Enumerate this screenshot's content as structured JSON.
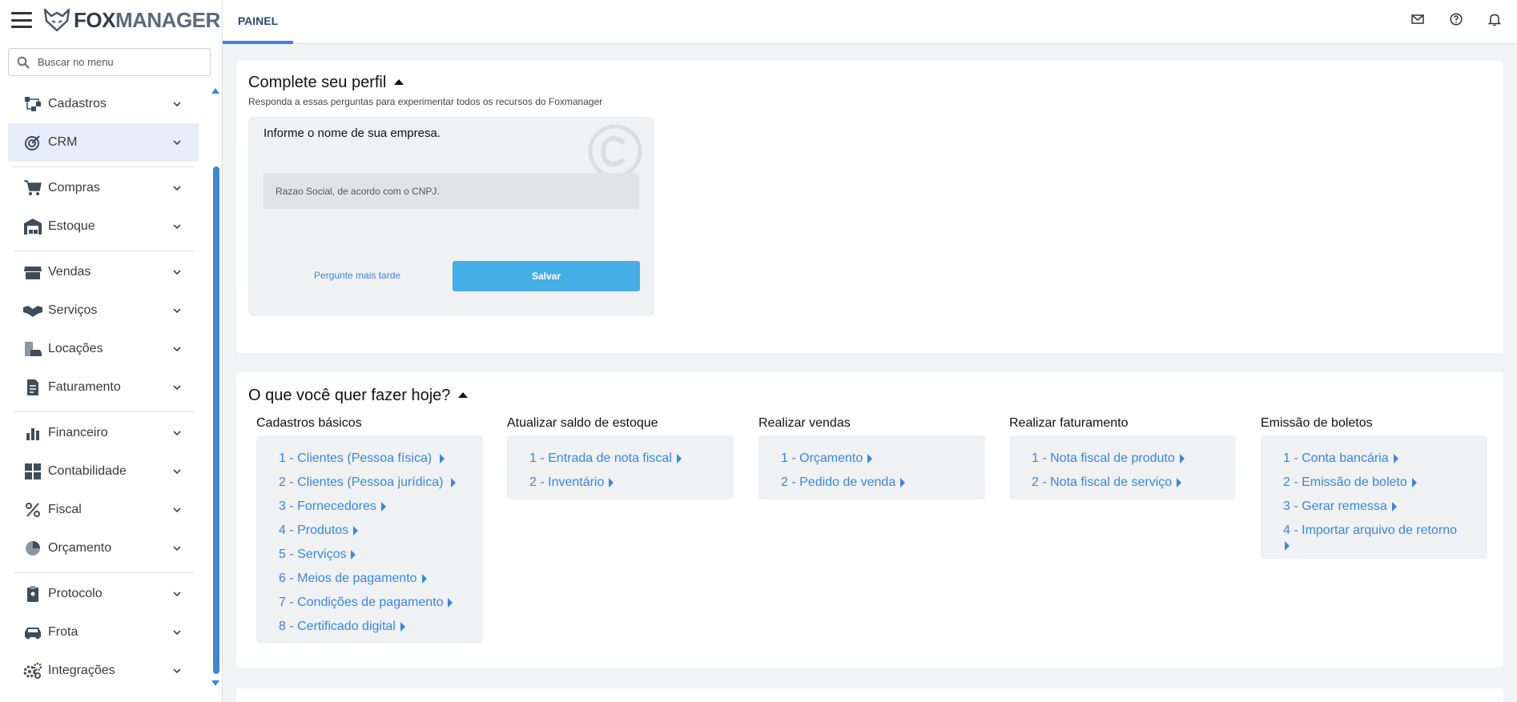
{
  "app": {
    "logo_text_part1": "FOX",
    "logo_text_part2": "MANAGER"
  },
  "search": {
    "placeholder": "Buscar no menu"
  },
  "sidebar": {
    "items": [
      {
        "label": "Cadastros",
        "icon": "hierarchy-icon"
      },
      {
        "label": "CRM",
        "icon": "target-icon"
      },
      {
        "label": "Compras",
        "icon": "cart-icon"
      },
      {
        "label": "Estoque",
        "icon": "warehouse-icon"
      },
      {
        "label": "Vendas",
        "icon": "store-icon"
      },
      {
        "label": "Serviços",
        "icon": "handshake-icon"
      },
      {
        "label": "Locações",
        "icon": "building-car-icon"
      },
      {
        "label": "Faturamento",
        "icon": "invoice-icon"
      },
      {
        "label": "Financeiro",
        "icon": "bar-chart-icon"
      },
      {
        "label": "Contabilidade",
        "icon": "calculator-icon"
      },
      {
        "label": "Fiscal",
        "icon": "percent-icon"
      },
      {
        "label": "Orçamento",
        "icon": "pie-chart-icon"
      },
      {
        "label": "Protocolo",
        "icon": "clipboard-icon"
      },
      {
        "label": "Frota",
        "icon": "car-icon"
      },
      {
        "label": "Integrações",
        "icon": "gears-icon"
      }
    ]
  },
  "header": {
    "tab_label": "PAINEL"
  },
  "profile_card": {
    "title": "Complete seu perfil",
    "subtitle": "Responda a essas perguntas para experimentar todos os recursos do Foxmanager",
    "question": "Informe o nome de sua empresa.",
    "input_placeholder": "Razao Social, de acordo com o CNPJ.",
    "later_label": "Pergunte mais tarde",
    "save_label": "Salvar"
  },
  "tasks_card": {
    "title": "O que você quer fazer hoje?",
    "columns": [
      {
        "title": "Cadastros básicos",
        "links": [
          "1 - Clientes (Pessoa física)",
          "2 - Clientes (Pessoa jurídica)",
          "3 - Fornecedores",
          "4 - Produtos",
          "5 - Serviços",
          "6 - Meios de pagamento",
          "7 - Condições de pagamento",
          "8 - Certificado digital"
        ]
      },
      {
        "title": "Atualizar saldo de estoque",
        "links": [
          "1 - Entrada de nota fiscal",
          "2 - Inventário"
        ]
      },
      {
        "title": "Realizar vendas",
        "links": [
          "1 - Orçamento",
          "2 - Pedido de venda"
        ]
      },
      {
        "title": "Realizar faturamento",
        "links": [
          "1 - Nota fiscal de produto",
          "2 - Nota fiscal de serviço"
        ]
      },
      {
        "title": "Emissão de boletos",
        "links": [
          "1 - Conta bancária",
          "2 - Emissão de boleto",
          "3 - Gerar remessa",
          "4 - Importar arquivo de retorno"
        ]
      }
    ]
  },
  "colors": {
    "accent": "#3b86d9",
    "button": "#45aee6",
    "active_bg": "#e7eef9"
  }
}
